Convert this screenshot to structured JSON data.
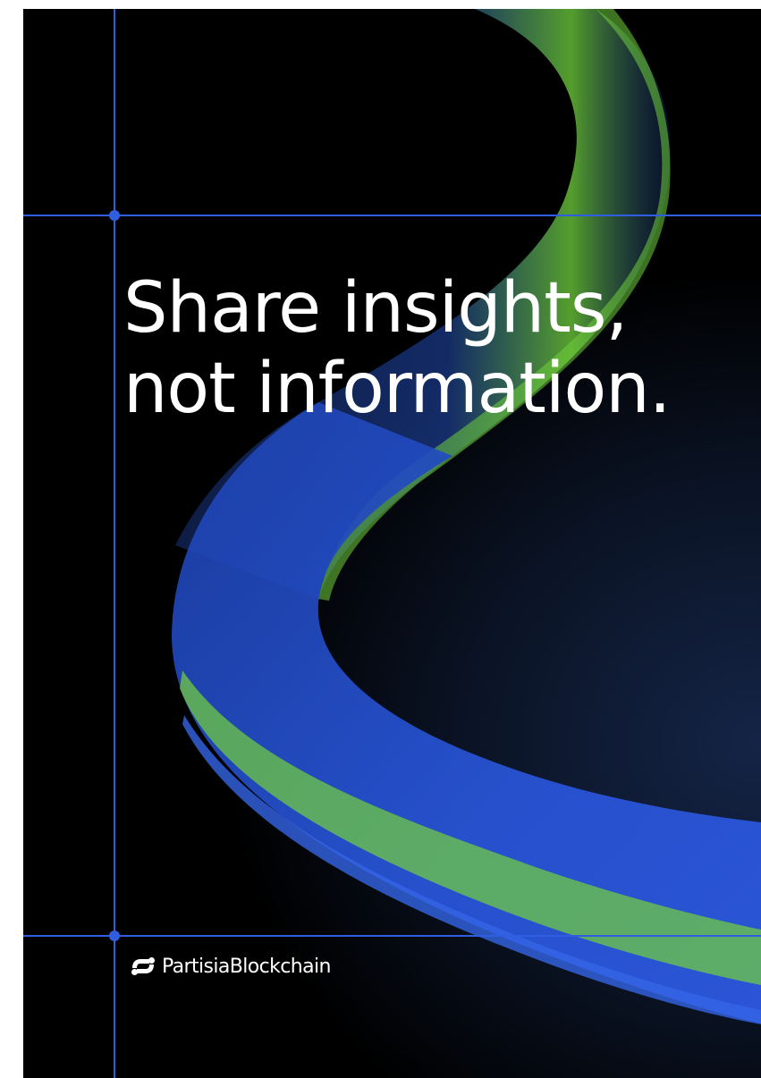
{
  "poster": {
    "headline_line1": "Share insights,",
    "headline_line2": "not information.",
    "brand_name": "PartisiaBlockchain",
    "brand_icon": "partisia-logo-icon"
  },
  "colors": {
    "background": "#000000",
    "guide_lines": "#2f5ee0",
    "ribbon_blue": "#2a55d6",
    "ribbon_green": "#7cd63a",
    "text": "#ffffff"
  }
}
